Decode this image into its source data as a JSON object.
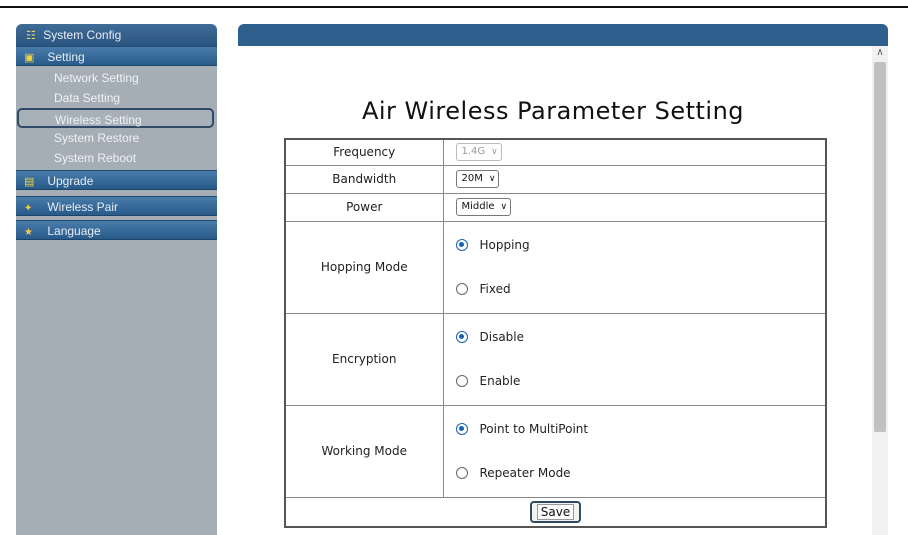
{
  "sidebar": {
    "header": "System Config",
    "groups": [
      {
        "label": "Setting",
        "icon": "monitor-icon",
        "items": [
          "Network Setting",
          "Data Setting",
          "Wireless Setting",
          "System Restore",
          "System Reboot"
        ],
        "active_item": "Wireless Setting"
      },
      {
        "label": "Upgrade",
        "icon": "chip-icon"
      },
      {
        "label": "Wireless Pair",
        "icon": "link-icon"
      },
      {
        "label": "Language",
        "icon": "globe-icon"
      }
    ]
  },
  "main": {
    "title": "Air Wireless Parameter Setting",
    "fields": {
      "frequency": {
        "label": "Frequency",
        "value": "1.4G",
        "disabled": true
      },
      "bandwidth": {
        "label": "Bandwidth",
        "value": "20M"
      },
      "power": {
        "label": "Power",
        "value": "Middle"
      },
      "hopping_mode": {
        "label": "Hopping Mode",
        "options": [
          "Hopping",
          "Fixed"
        ],
        "selected": "Hopping"
      },
      "encryption": {
        "label": "Encryption",
        "options": [
          "Disable",
          "Enable"
        ],
        "selected": "Disable"
      },
      "working_mode": {
        "label": "Working Mode",
        "options": [
          "Point to MultiPoint",
          "Repeater Mode"
        ],
        "selected": "Point to MultiPoint"
      }
    },
    "save_label": "Save"
  },
  "colors": {
    "header_blue": "#2e5f8d",
    "sidebar_gray": "#a6aeb5",
    "radio_blue": "#1a5fb4"
  }
}
